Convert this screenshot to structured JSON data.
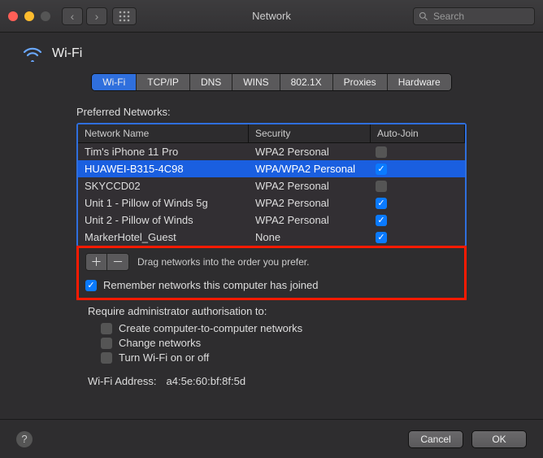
{
  "window": {
    "title": "Network",
    "search_placeholder": "Search"
  },
  "header": {
    "title": "Wi-Fi"
  },
  "tabs": [
    {
      "label": "Wi-Fi",
      "selected": true
    },
    {
      "label": "TCP/IP",
      "selected": false
    },
    {
      "label": "DNS",
      "selected": false
    },
    {
      "label": "WINS",
      "selected": false
    },
    {
      "label": "802.1X",
      "selected": false
    },
    {
      "label": "Proxies",
      "selected": false
    },
    {
      "label": "Hardware",
      "selected": false
    }
  ],
  "networks": {
    "section_label": "Preferred Networks:",
    "columns": {
      "name": "Network Name",
      "sec": "Security",
      "aj": "Auto-Join"
    },
    "rows": [
      {
        "name": "Tim's iPhone 11 Pro",
        "sec": "WPA2 Personal",
        "autojoin": false,
        "selected": false
      },
      {
        "name": "HUAWEI-B315-4C98",
        "sec": "WPA/WPA2 Personal",
        "autojoin": true,
        "selected": true
      },
      {
        "name": "SKYCCD02",
        "sec": "WPA2 Personal",
        "autojoin": false,
        "selected": false
      },
      {
        "name": "Unit 1 - Pillow of Winds 5g",
        "sec": "WPA2 Personal",
        "autojoin": true,
        "selected": false
      },
      {
        "name": "Unit 2 - Pillow of Winds",
        "sec": "WPA2 Personal",
        "autojoin": true,
        "selected": false
      },
      {
        "name": "MarkerHotel_Guest",
        "sec": "None",
        "autojoin": true,
        "selected": false
      }
    ],
    "hint": "Drag networks into the order you prefer.",
    "remember": {
      "label": "Remember networks this computer has joined",
      "checked": true
    }
  },
  "auth": {
    "label": "Require administrator authorisation to:",
    "options": [
      {
        "label": "Create computer-to-computer networks",
        "checked": false
      },
      {
        "label": "Change networks",
        "checked": false
      },
      {
        "label": "Turn Wi-Fi on or off",
        "checked": false
      }
    ]
  },
  "wifi_address": {
    "label": "Wi-Fi Address:",
    "value": "a4:5e:60:bf:8f:5d"
  },
  "footer": {
    "cancel": "Cancel",
    "ok": "OK"
  },
  "glyphs": {
    "plus": "＋",
    "minus": "－",
    "back": "‹",
    "fwd": "›",
    "grid": "⋮⋮⋮",
    "check": "✓",
    "help": "?",
    "search": "🔍"
  }
}
